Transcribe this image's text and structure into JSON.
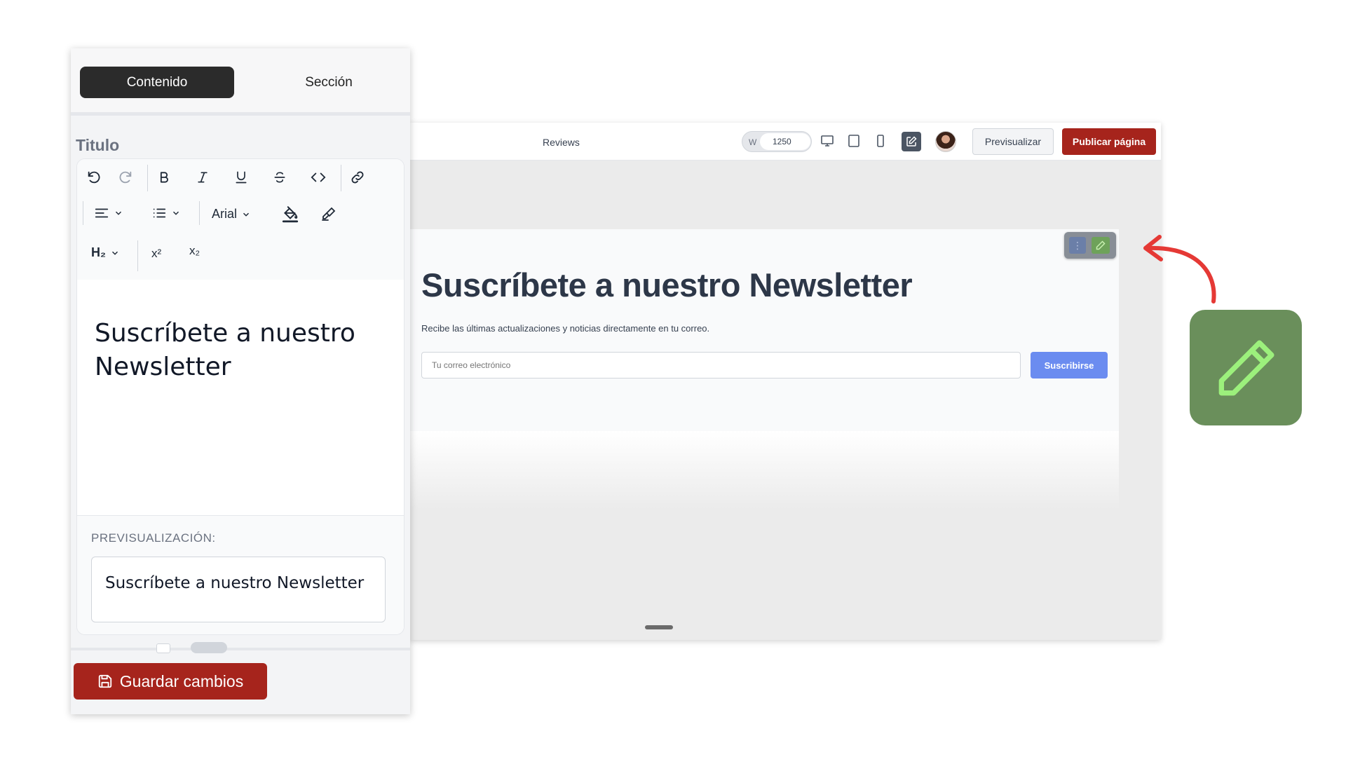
{
  "panel": {
    "tabs": [
      {
        "label": "Contenido",
        "active": true
      },
      {
        "label": "Sección",
        "active": false
      }
    ],
    "field_label": "Titulo",
    "toolbar": {
      "font_name": "Arial",
      "heading": "H₂",
      "superscript": "x²",
      "subscript": "x₂"
    },
    "editor_content": "Suscríbete a nuestro Newsletter",
    "preview_label": "PREVISUALIZACIÓN:",
    "preview_text": "Suscríbete a nuestro Newsletter",
    "save_label": "Guardar cambios"
  },
  "editor": {
    "tab_label": "Reviews",
    "width_label": "W",
    "width_value": "1250",
    "preview_button": "Previsualizar",
    "publish_button": "Publicar página"
  },
  "section": {
    "title": "Suscríbete a nuestro Newsletter",
    "description": "Recibe las últimas actualizaciones y noticias directamente en tu correo.",
    "email_placeholder": "Tu correo electrónico",
    "submit_label": "Suscribirse"
  },
  "colors": {
    "primary_red": "#a6241c",
    "edit_green": "#6a8f5b",
    "subscribe_blue": "#6b8cf0",
    "annotation_arrow": "#e53935"
  }
}
